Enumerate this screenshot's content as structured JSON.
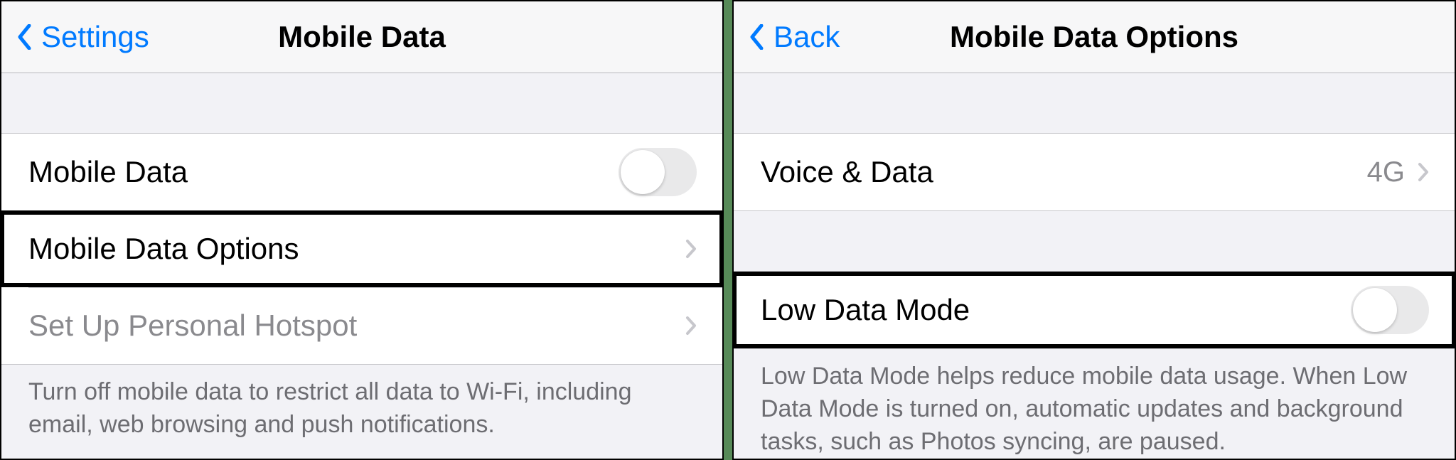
{
  "left": {
    "nav": {
      "back": "Settings",
      "title": "Mobile Data"
    },
    "rows": {
      "mobileData": {
        "label": "Mobile Data",
        "toggle": "off"
      },
      "options": {
        "label": "Mobile Data Options"
      },
      "hotspot": {
        "label": "Set Up Personal Hotspot"
      }
    },
    "footer": "Turn off mobile data to restrict all data to Wi-Fi, including email, web browsing and push notifications."
  },
  "right": {
    "nav": {
      "back": "Back",
      "title": "Mobile Data Options"
    },
    "rows": {
      "voiceData": {
        "label": "Voice & Data",
        "value": "4G"
      },
      "lowData": {
        "label": "Low Data Mode",
        "toggle": "off"
      }
    },
    "footer": "Low Data Mode helps reduce mobile data usage. When Low Data Mode is turned on, automatic updates and background tasks, such as Photos syncing, are paused."
  }
}
